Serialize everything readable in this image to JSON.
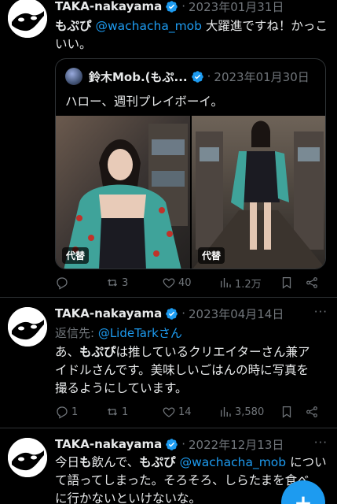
{
  "tweets": [
    {
      "author": "TAKA-nakayama",
      "date": "2023年01月31日",
      "body_name": "もぷぴ",
      "body_mention": "@wachacha_mob",
      "body_text": " 大躍進ですね！かっこいい。",
      "quote": {
        "author": "鈴木Mob.(もぷ...",
        "date": "2023年01月30日",
        "text": "ハロー、週刊プレイボーイ。",
        "media_badge_1": "代替",
        "media_badge_2": "代替"
      },
      "actions": {
        "replies": "",
        "retweets": "3",
        "likes": "40",
        "views": "1.2万"
      }
    },
    {
      "author": "TAKA-nakayama",
      "date": "2023年04月14日",
      "reply_prefix": "返信先: ",
      "reply_to": "@LideTarkさん",
      "body_lead": "あ、",
      "body_name": "もぷぴ",
      "body_line1_rest": "は推しているクリエイターさん兼ア",
      "body_line2": "イドルさんです。美味しいごはんの時に写真を",
      "body_line3": "撮るようにしています。",
      "actions": {
        "replies": "1",
        "retweets": "1",
        "likes": "14",
        "views": "3,580"
      }
    },
    {
      "author": "TAKA-nakayama",
      "date": "2022年12月13日",
      "body_lead": "今日",
      "body_bold_mo": "も",
      "body_mid": "飲んで、",
      "body_name": "もぷぴ",
      "body_mention": "@wachacha_mob",
      "body_line1_rest": " につい",
      "body_line2": "て語ってしまった。そろそろ、しらたまを食べ",
      "body_line3": "に行かないといけないな。"
    }
  ],
  "fab_label": "+",
  "more_label": "···",
  "separator": "·",
  "colors": {
    "accent": "#1d9bf0",
    "muted": "#71767b",
    "background": "#000000",
    "border": "#2f3336"
  }
}
